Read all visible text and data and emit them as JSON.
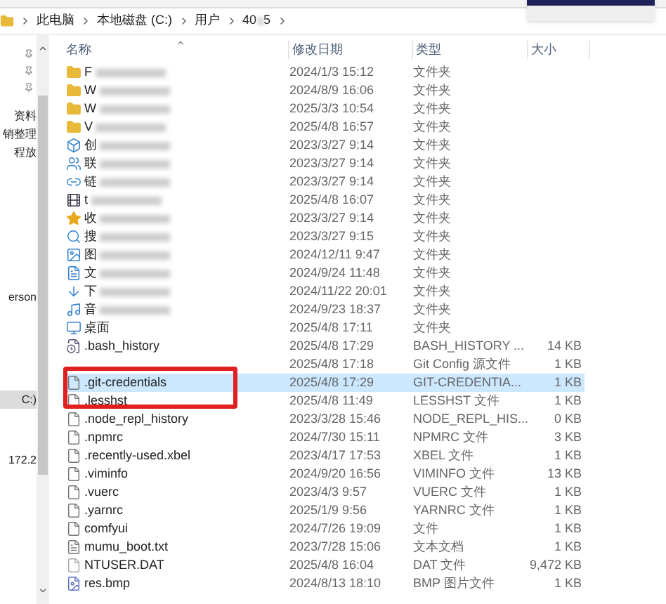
{
  "breadcrumb": {
    "parts": [
      {
        "text": "此电脑"
      },
      {
        "text": "本地磁盘 (C:)"
      },
      {
        "text": "用户"
      },
      {
        "text": "40",
        "blurred_tail": "5"
      }
    ]
  },
  "sidebar": {
    "items": [
      {
        "label": "资料",
        "selected": false
      },
      {
        "label": "销整理",
        "selected": false
      },
      {
        "label": "程放",
        "selected": false
      },
      {
        "label": "erson",
        "selected": false
      },
      {
        "label": "C:)",
        "selected": true
      },
      {
        "label": "172.2",
        "selected": false
      }
    ]
  },
  "table": {
    "columns": [
      "名称",
      "修改日期",
      "类型",
      "大小"
    ],
    "rows": [
      {
        "kind": "folder",
        "name": "F",
        "blurred": true,
        "date": "2024/1/3 15:12",
        "type": "文件夹",
        "selected": false
      },
      {
        "kind": "folder",
        "name": "W",
        "blurred": true,
        "date": "2024/8/9 16:06",
        "type": "文件夹",
        "selected": false
      },
      {
        "kind": "folder",
        "name": "W",
        "blurred": true,
        "date": "2025/3/3 10:54",
        "type": "文件夹",
        "selected": false
      },
      {
        "kind": "folder",
        "name": "V",
        "blurred": true,
        "date": "2025/4/8 16:57",
        "type": "文件夹",
        "selected": false
      },
      {
        "kind": "objects",
        "name": "创",
        "blurred": true,
        "date": "2023/3/27 9:14",
        "type": "文件夹",
        "selected": false
      },
      {
        "kind": "contacts",
        "name": "联",
        "blurred": true,
        "date": "2023/3/27 9:14",
        "type": "文件夹",
        "selected": false
      },
      {
        "kind": "link",
        "name": "链",
        "blurred": true,
        "date": "2023/3/27 9:14",
        "type": "文件夹",
        "selected": false
      },
      {
        "kind": "video",
        "name": "t",
        "blurred": true,
        "date": "2025/4/8 16:07",
        "type": "文件夹",
        "selected": false
      },
      {
        "kind": "star",
        "name": "收",
        "blurred": true,
        "date": "2023/3/27 9:14",
        "type": "文件夹",
        "selected": false
      },
      {
        "kind": "search",
        "name": "搜",
        "blurred": true,
        "date": "2023/3/27 9:15",
        "type": "文件夹",
        "selected": false
      },
      {
        "kind": "pictures",
        "name": "图",
        "blurred": true,
        "date": "2024/12/11 9:47",
        "type": "文件夹",
        "selected": false
      },
      {
        "kind": "document",
        "name": "文",
        "blurred": true,
        "date": "2024/9/24 11:48",
        "type": "文件夹",
        "selected": false
      },
      {
        "kind": "download",
        "name": "下",
        "blurred": true,
        "date": "2024/11/22 20:01",
        "type": "文件夹",
        "selected": false
      },
      {
        "kind": "music",
        "name": "音",
        "blurred": true,
        "date": "2024/9/23 18:37",
        "type": "文件夹",
        "selected": false
      },
      {
        "kind": "desktop",
        "name": "桌面",
        "blurred": false,
        "date": "2025/4/8 17:11",
        "type": "文件夹",
        "selected": false
      },
      {
        "kind": "history",
        "name": ".bash_history",
        "blurred": false,
        "date": "2025/4/8 17:29",
        "type": "BASH_HISTORY ...",
        "size": "14 KB",
        "selected": false
      },
      {
        "kind": "none",
        "date": "2025/4/8 17:18",
        "type": "Git Config 源文件",
        "size": "1 KB",
        "selected": false
      },
      {
        "kind": "file",
        "name": ".git-credentials",
        "blurred": false,
        "date": "2025/4/8 17:29",
        "type": "GIT-CREDENTIA...",
        "size": "1 KB",
        "selected": true
      },
      {
        "kind": "file",
        "name": ".lesshst",
        "blurred": false,
        "date": "2025/4/8 11:49",
        "type": "LESSHST 文件",
        "size": "1 KB",
        "selected": false
      },
      {
        "kind": "file",
        "name": ".node_repl_history",
        "blurred": false,
        "date": "2023/3/28 15:46",
        "type": "NODE_REPL_HIS...",
        "size": "0 KB",
        "selected": false
      },
      {
        "kind": "file",
        "name": ".npmrc",
        "blurred": false,
        "date": "2024/7/30 15:11",
        "type": "NPMRC 文件",
        "size": "3 KB",
        "selected": false
      },
      {
        "kind": "file",
        "name": ".recently-used.xbel",
        "blurred": false,
        "date": "2023/4/17 17:53",
        "type": "XBEL 文件",
        "size": "1 KB",
        "selected": false
      },
      {
        "kind": "file",
        "name": ".viminfo",
        "blurred": false,
        "date": "2024/9/20 16:56",
        "type": "VIMINFO 文件",
        "size": "13 KB",
        "selected": false
      },
      {
        "kind": "file",
        "name": ".vuerc",
        "blurred": false,
        "date": "2023/4/3 9:57",
        "type": "VUERC 文件",
        "size": "1 KB",
        "selected": false
      },
      {
        "kind": "file",
        "name": ".yarnrc",
        "blurred": false,
        "date": "2025/1/9 9:56",
        "type": "YARNRC 文件",
        "size": "1 KB",
        "selected": false
      },
      {
        "kind": "file",
        "name": "comfyui",
        "blurred": false,
        "date": "2024/7/26 19:09",
        "type": "文件",
        "size": "1 KB",
        "selected": false
      },
      {
        "kind": "text",
        "name": "mumu_boot.txt",
        "blurred": false,
        "date": "2023/7/28 15:06",
        "type": "文本文档",
        "size": "1 KB",
        "selected": false
      },
      {
        "kind": "blank",
        "name": "NTUSER.DAT",
        "blurred": false,
        "date": "2025/4/8 16:04",
        "type": "DAT 文件",
        "size": "9,472 KB",
        "selected": false
      },
      {
        "kind": "image",
        "name": "res.bmp",
        "blurred": false,
        "date": "2024/8/13 18:10",
        "type": "BMP 图片文件",
        "size": "1 KB",
        "selected": false
      }
    ]
  }
}
